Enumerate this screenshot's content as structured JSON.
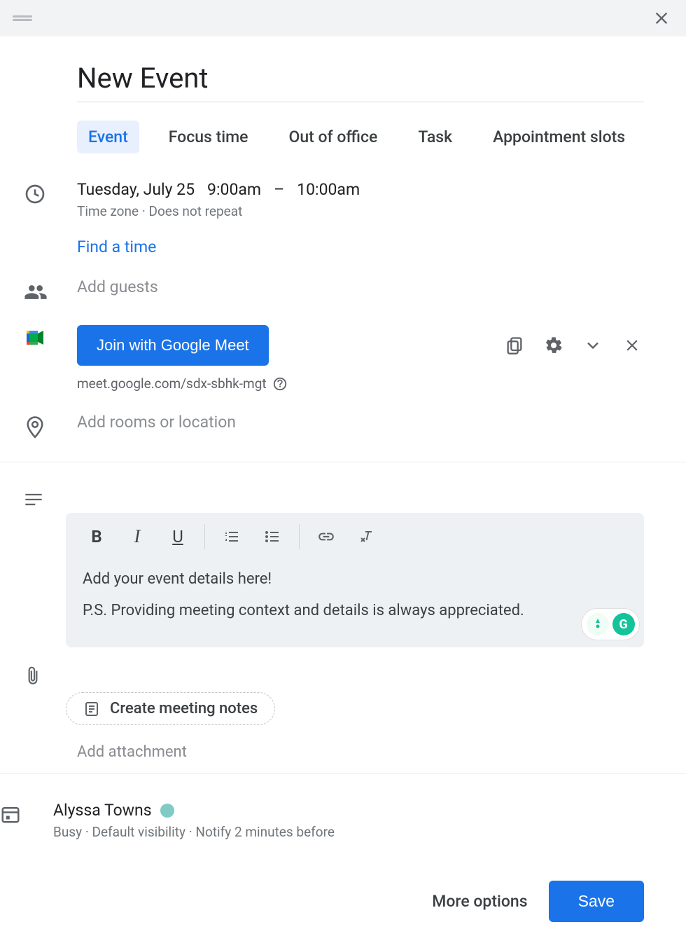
{
  "title": "New Event",
  "tabs": [
    {
      "label": "Event",
      "active": true
    },
    {
      "label": "Focus time",
      "active": false
    },
    {
      "label": "Out of office",
      "active": false
    },
    {
      "label": "Task",
      "active": false
    },
    {
      "label": "Appointment slots",
      "active": false
    }
  ],
  "date": {
    "day": "Tuesday, July 25",
    "start": "9:00am",
    "separator": "–",
    "end": "10:00am",
    "timezone": "Time zone",
    "repeat": "Does not repeat",
    "find_time": "Find a time"
  },
  "guests": {
    "placeholder": "Add guests"
  },
  "meet": {
    "button": "Join with Google Meet",
    "url": "meet.google.com/sdx-sbhk-mgt"
  },
  "location": {
    "placeholder": "Add rooms or location"
  },
  "description": {
    "line1": "Add your event details here!",
    "line2": "P.S. Providing meeting context and details is always appreciated."
  },
  "notes": {
    "create": "Create meeting notes",
    "attach": "Add attachment"
  },
  "calendar": {
    "owner": "Alyssa Towns",
    "color": "#80cbc4",
    "busy": "Busy",
    "visibility": "Default visibility",
    "notify": "Notify 2 minutes before"
  },
  "footer": {
    "more": "More options",
    "save": "Save"
  }
}
